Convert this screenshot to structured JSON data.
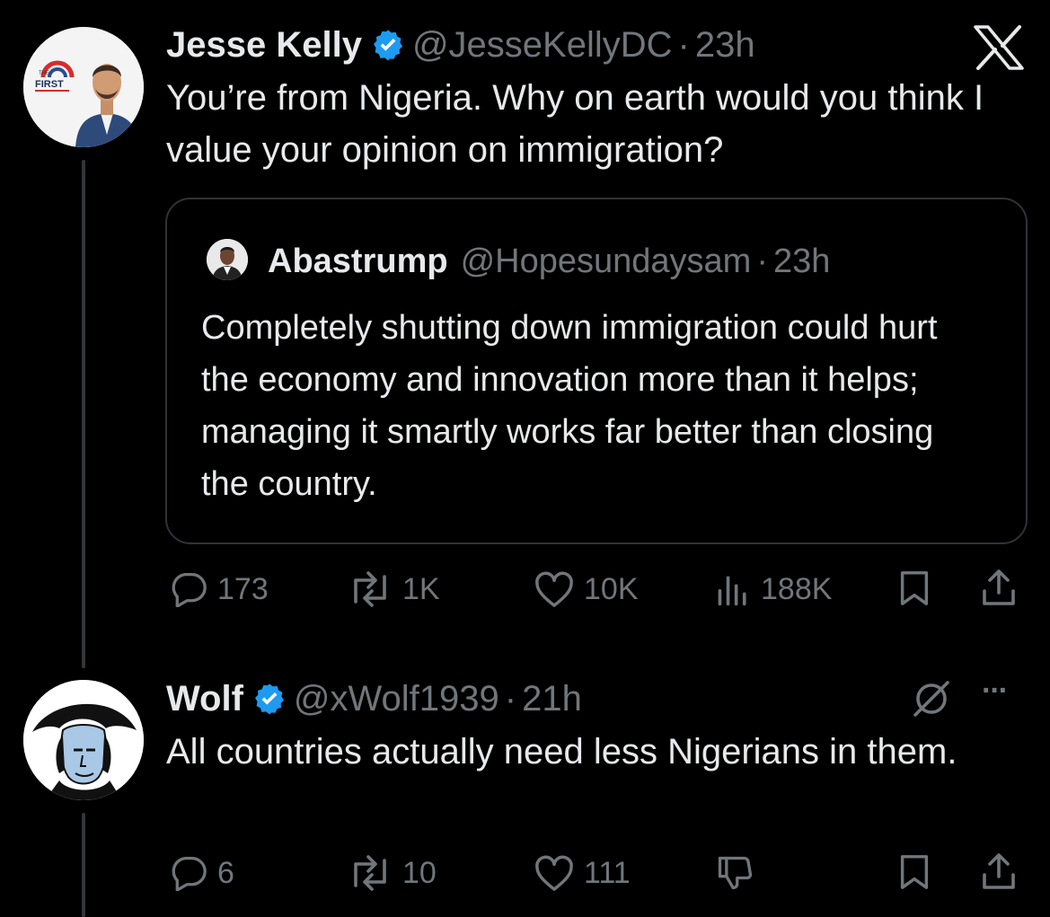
{
  "post1": {
    "author_name": "Jesse Kelly",
    "handle": "@JesseKellyDC",
    "separator": "·",
    "time": "23h",
    "text": "You’re from Nigeria. Why on earth would you think I value your opinion on immigration?",
    "avatar_logo_text": "FIRST",
    "avatar_logo_small": "THE",
    "platform_logo": "X",
    "quote": {
      "author_name": "Abastrump",
      "handle": "@Hopesundaysam",
      "separator": "·",
      "time": "23h",
      "text": "Completely shutting down immigration could hurt the economy and innovation more than it helps; managing it smartly works far better than closing the country."
    },
    "actions": {
      "replies": "173",
      "reposts": "1K",
      "likes": "10K",
      "views": "188K"
    }
  },
  "post2": {
    "author_name": "Wolf",
    "handle": "@xWolf1939",
    "separator": "·",
    "time": "21h",
    "text": "All countries actually need less Nigerians in them.",
    "more_label": "···",
    "actions": {
      "replies": "6",
      "reposts": "10",
      "likes": "111"
    }
  },
  "colors": {
    "background": "#000000",
    "text": "#e7e9ea",
    "muted": "#71767b",
    "verified": "#1d9bf0",
    "border": "#2f3336"
  },
  "icons": [
    "verified-badge-icon",
    "x-logo-icon",
    "reply-icon",
    "repost-icon",
    "like-icon",
    "views-icon",
    "bookmark-icon",
    "share-icon",
    "grok-icon",
    "more-icon",
    "dislike-icon"
  ]
}
